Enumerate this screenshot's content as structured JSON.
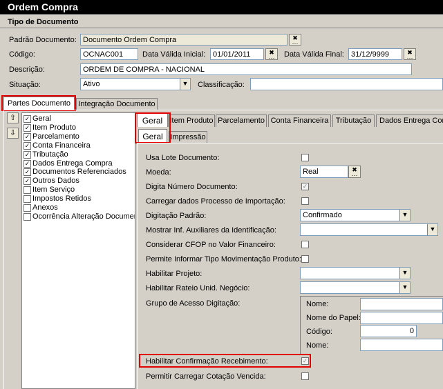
{
  "window": {
    "title": "Ordem Compra",
    "section_title": "Tipo de Documento"
  },
  "header_form": {
    "padrao_documento_label": "Padrão Documento:",
    "padrao_documento_value": "Documento Ordem Compra",
    "codigo_label": "Código:",
    "codigo_value": "OCNAC001",
    "data_valida_inicial_label": "Data Válida Inicial:",
    "data_valida_inicial_value": "01/01/2011",
    "data_valida_final_label": "Data Válida Final:",
    "data_valida_final_value": "31/12/9999",
    "descricao_label": "Descrição:",
    "descricao_value": "ORDEM DE COMPRA - NACIONAL",
    "situacao_label": "Situação:",
    "situacao_value": "Ativo",
    "classificacao_label": "Classificação:",
    "classificacao_value": ""
  },
  "outer_tabs": [
    {
      "label": "Partes Documento",
      "active": true
    },
    {
      "label": "Integração Documento",
      "active": false
    }
  ],
  "tree_items": [
    {
      "label": "Geral",
      "checked": true
    },
    {
      "label": "Item Produto",
      "checked": true
    },
    {
      "label": "Parcelamento",
      "checked": true
    },
    {
      "label": "Conta Financeira",
      "checked": true
    },
    {
      "label": "Tributação",
      "checked": true
    },
    {
      "label": "Dados Entrega Compra",
      "checked": true
    },
    {
      "label": "Documentos Referenciados",
      "checked": true
    },
    {
      "label": "Outros Dados",
      "checked": true
    },
    {
      "label": "Item Serviço",
      "checked": false
    },
    {
      "label": "Impostos Retidos",
      "checked": false
    },
    {
      "label": "Anexos",
      "checked": false
    },
    {
      "label": "Ocorrência Alteração Documento",
      "checked": false
    }
  ],
  "inner_tabs": [
    {
      "label": "Geral",
      "active": true
    },
    {
      "label": "Item Produto",
      "active": false
    },
    {
      "label": "Parcelamento",
      "active": false
    },
    {
      "label": "Conta Financeira",
      "active": false
    },
    {
      "label": "Tributação",
      "active": false
    },
    {
      "label": "Dados Entrega Compra",
      "active": false
    }
  ],
  "sub_tabs": [
    {
      "label": "Geral",
      "active": true
    },
    {
      "label": "Impressão",
      "active": false
    }
  ],
  "settings": {
    "usa_lote_documento_label": "Usa Lote Documento:",
    "usa_lote_documento_checked": false,
    "moeda_label": "Moeda:",
    "moeda_value": "Real",
    "digita_numero_documento_label": "Digita Número Documento:",
    "digita_numero_documento_checked": true,
    "carregar_dados_importacao_label": "Carregar dados Processo de Importação:",
    "carregar_dados_importacao_checked": false,
    "digitacao_padrao_label": "Digitação Padrão:",
    "digitacao_padrao_value": "Confirmado",
    "mostrar_inf_auxiliares_label": "Mostrar Inf. Auxiliares da Identificação:",
    "mostrar_inf_auxiliares_value": "",
    "considerar_cfop_label": "Considerar CFOP no Valor Financeiro:",
    "considerar_cfop_checked": false,
    "permite_informar_tipo_label": "Permite Informar Tipo Movimentação Produto:",
    "permite_informar_tipo_checked": false,
    "habilitar_projeto_label": "Habilitar Projeto:",
    "habilitar_projeto_value": "",
    "habilitar_rateio_label": "Habilitar Rateio Unid. Negócio:",
    "habilitar_rateio_value": "",
    "grupo_acesso_label": "Grupo de Acesso Digitação:",
    "grupo_nome_label": "Nome:",
    "grupo_nome_value": "",
    "grupo_nome_papel_label": "Nome do Papel:",
    "grupo_nome_papel_value": "",
    "grupo_codigo_label": "Código:",
    "grupo_codigo_value": "0",
    "grupo_nome2_label": "Nome:",
    "grupo_nome2_value": "",
    "habilitar_confirmacao_label": "Habilitar Confirmação Recebimento:",
    "habilitar_confirmacao_checked": true,
    "permitir_carregar_cotacao_label": "Permitir Carregar Cotação Vencida:",
    "permitir_carregar_cotacao_checked": false
  },
  "icons": {
    "lookup": "x-ellipsis-icon",
    "dropdown": "chevron-down-icon",
    "move_up": "arrow-up-icon",
    "move_down": "arrow-down-icon",
    "checkmark": "checkmark-icon"
  },
  "colors": {
    "title_bar": "#000000",
    "window_bg": "#d4d0c8",
    "highlight_red": "#e00000",
    "field_border": "#7f9db9"
  }
}
